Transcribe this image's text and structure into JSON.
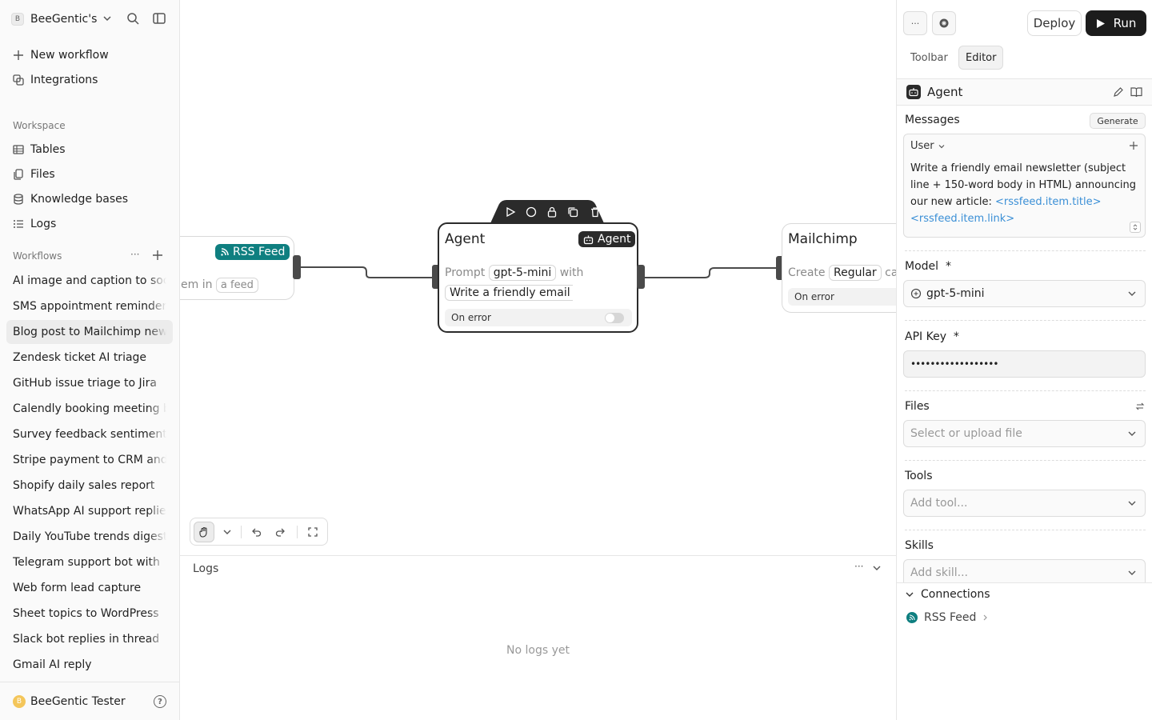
{
  "sidebar": {
    "workspace_badge": "B",
    "workspace_name": "BeeGentic's",
    "new_workflow": "New workflow",
    "integrations": "Integrations",
    "workspace_section": "Workspace",
    "workspace_items": [
      "Tables",
      "Files",
      "Knowledge bases",
      "Logs"
    ],
    "workflows_section": "Workflows",
    "workflows": [
      "AI image and caption to social",
      "SMS appointment reminders",
      "Blog post to Mailchimp newsletter",
      "Zendesk ticket AI triage",
      "GitHub issue triage to Jira",
      "Calendly booking meeting brief",
      "Survey feedback sentiment",
      "Stripe payment to CRM and",
      "Shopify daily sales report",
      "WhatsApp AI support replies",
      "Daily YouTube trends digest",
      "Telegram support bot with",
      "Web form lead capture",
      "Sheet topics to WordPress",
      "Slack bot replies in thread",
      "Gmail AI reply"
    ],
    "user_badge": "B",
    "user_name": "BeeGentic Tester",
    "help_icon": "?"
  },
  "canvas": {
    "rss_node": {
      "badge": "RSS Feed",
      "text_prefix": "em in",
      "chip": "a feed"
    },
    "agent_node": {
      "title": "Agent",
      "badge": "Agent",
      "prompt_label": "Prompt",
      "model_chip": "gpt-5-mini",
      "with_label": "with",
      "message_chip": "Write a friendly email r",
      "on_error": "On error"
    },
    "mailchimp_node": {
      "title": "Mailchimp",
      "create_label": "Create",
      "type_chip": "Regular",
      "tail": "car",
      "on_error": "On error"
    }
  },
  "logs": {
    "title": "Logs",
    "empty": "No logs yet"
  },
  "right_panel": {
    "more": "···",
    "deploy": "Deploy",
    "run": "Run",
    "tabs": [
      "Toolbar",
      "Editor"
    ],
    "block_title": "Agent",
    "messages_label": "Messages",
    "generate": "Generate",
    "role": "User",
    "message_text": "Write a friendly email newsletter (subject line + 150-word body in HTML) announcing our new article: ",
    "var_title": "<rssfeed.item.title>",
    "var_link": "<rssfeed.item.link>",
    "model_label": "Model",
    "required": "*",
    "model_value": "gpt-5-mini",
    "apikey_label": "API Key",
    "apikey_value": "••••••••••••••••••",
    "files_label": "Files",
    "files_placeholder": "Select or upload file",
    "tools_label": "Tools",
    "tools_placeholder": "Add tool...",
    "skills_label": "Skills",
    "skills_placeholder": "Add skill...",
    "connections_label": "Connections",
    "connection_item": "RSS Feed"
  },
  "colors": {
    "accent_dark": "#1c1c1c",
    "rss_teal": "#0f7f80",
    "variable_blue": "#3a8fd6"
  }
}
